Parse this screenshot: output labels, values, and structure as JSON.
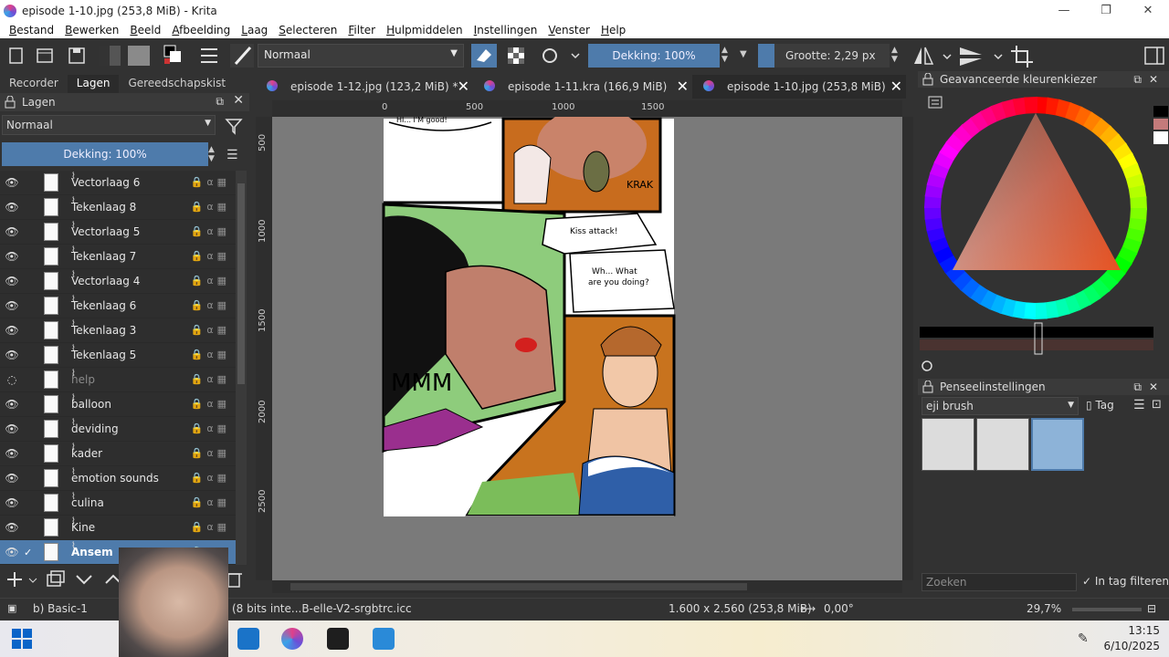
{
  "window": {
    "title": "episode 1-10.jpg (253,8 MiB)  - Krita",
    "controls": {
      "minimize": "—",
      "maximize": "❐",
      "close": "✕"
    }
  },
  "menubar": [
    "Bestand",
    "Bewerken",
    "Beeld",
    "Afbeelding",
    "Laag",
    "Selecteren",
    "Filter",
    "Hulpmiddelen",
    "Instellingen",
    "Venster",
    "Help"
  ],
  "toolbar": {
    "blend_mode": "Normaal",
    "opacity": "Dekking: 100%",
    "size": "Grootte: 2,29 px"
  },
  "left_dock": {
    "tabs": [
      "Recorder",
      "Lagen",
      "Gereedschapskist"
    ],
    "active_tab": "Lagen",
    "panel_title": "Lagen",
    "blend_mode": "Normaal",
    "opacity": "Dekking:  100%",
    "layers": [
      {
        "name": "Vectorlaag 6",
        "visible": true,
        "dim": false
      },
      {
        "name": "Tekenlaag 8",
        "visible": true,
        "dim": false
      },
      {
        "name": "Vectorlaag 5",
        "visible": true,
        "dim": false
      },
      {
        "name": "Tekenlaag 7",
        "visible": true,
        "dim": false
      },
      {
        "name": "Vectorlaag 4",
        "visible": true,
        "dim": false
      },
      {
        "name": "Tekenlaag 6",
        "visible": true,
        "dim": false
      },
      {
        "name": "Tekenlaag 3",
        "visible": true,
        "dim": false
      },
      {
        "name": "Tekenlaag 5",
        "visible": true,
        "dim": false
      },
      {
        "name": "help",
        "visible": false,
        "dim": true
      },
      {
        "name": "balloon",
        "visible": true,
        "dim": false
      },
      {
        "name": "deviding",
        "visible": true,
        "dim": false
      },
      {
        "name": "kader",
        "visible": true,
        "dim": false
      },
      {
        "name": "emotion sounds",
        "visible": true,
        "dim": false
      },
      {
        "name": "culina",
        "visible": true,
        "dim": false
      },
      {
        "name": "Kine",
        "visible": true,
        "dim": false
      },
      {
        "name": "Ansem",
        "visible": true,
        "dim": false,
        "selected": true
      }
    ]
  },
  "document_tabs": [
    {
      "label": "episode 1-12.jpg (123,2 MiB) *",
      "active": false
    },
    {
      "label": "episode 1-11.kra (166,9 MiB)",
      "active": false
    },
    {
      "label": "episode 1-10.jpg (253,8 MiB)",
      "active": true
    }
  ],
  "rulers": {
    "horizontal": [
      "0",
      "500",
      "1000",
      "1500"
    ],
    "vertical": [
      "500",
      "1000",
      "1500",
      "2000",
      "2500"
    ]
  },
  "comic": {
    "bubble_top": "HI... I'M good!",
    "kiss_bubble": "Kiss attack!",
    "question_bubble_line1": "Wh... What",
    "question_bubble_line2": "are you doing?",
    "krak": "KRAK",
    "mmm": "MMM"
  },
  "right_dock": {
    "color_panel_title": "Geavanceerde kleurenkiezer",
    "brush_panel_title": "Penseelinstellingen",
    "brush_preset": "eji brush",
    "tag_label": "Tag",
    "search_placeholder": "Zoeken",
    "filter_label": "In tag filteren"
  },
  "statusbar": {
    "brush_name": "b) Basic-1",
    "color_profile": "(8 bits inte...B-elle-V2-srgbtrc.icc",
    "dimensions": "1.600 x 2.560 (253,8 MiB)",
    "rotation": "0,00°",
    "zoom": "29,7%"
  },
  "taskbar": {
    "time": "13:15",
    "date": "6/10/2025"
  },
  "colors": {
    "accent": "#4e7bab",
    "panel_bg": "#323232",
    "canvas_bg": "#7a7a7a"
  }
}
